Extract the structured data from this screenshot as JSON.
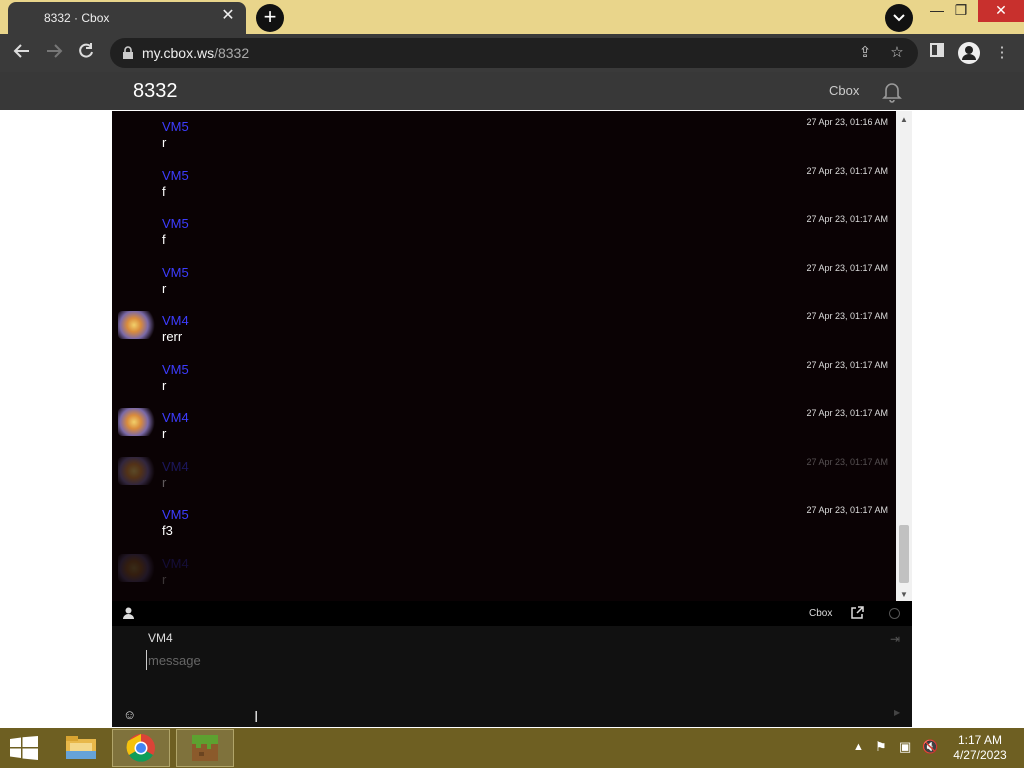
{
  "browser": {
    "tab_title": "8332 · Cbox",
    "tab_close": "✕",
    "new_tab": "+",
    "url_host": "my.cbox.ws",
    "url_path": "/8332",
    "window_minimize": "—",
    "window_restore": "❐",
    "window_close": "✕"
  },
  "site": {
    "title": "8332",
    "brand": "Cbox"
  },
  "chat": {
    "messages": [
      {
        "name": "VM5",
        "text": "r",
        "time": "27 Apr 23, 01:16 AM",
        "avatar": false
      },
      {
        "name": "VM5",
        "text": "f",
        "time": "27 Apr 23, 01:17 AM",
        "avatar": false
      },
      {
        "name": "VM5",
        "text": "f",
        "time": "27 Apr 23, 01:17 AM",
        "avatar": false
      },
      {
        "name": "VM5",
        "text": "r",
        "time": "27 Apr 23, 01:17 AM",
        "avatar": false
      },
      {
        "name": "VM4",
        "text": "rerr",
        "time": "27 Apr 23, 01:17 AM",
        "avatar": true
      },
      {
        "name": "VM5",
        "text": "r",
        "time": "27 Apr 23, 01:17 AM",
        "avatar": false
      },
      {
        "name": "VM4",
        "text": "r",
        "time": "27 Apr 23, 01:17 AM",
        "avatar": true
      },
      {
        "name": "VM4",
        "text": "r",
        "time": "27 Apr 23, 01:17 AM",
        "avatar": true
      },
      {
        "name": "VM5",
        "text": "f3",
        "time": "27 Apr 23, 01:17 AM",
        "avatar": false
      },
      {
        "name": "VM4",
        "text": "r",
        "time": "",
        "avatar": true
      }
    ],
    "toolbar_brand": "Cbox",
    "compose_name": "VM4",
    "message_placeholder": "message",
    "message_value": ""
  },
  "taskbar": {
    "time": "1:17 AM",
    "date": "4/27/2023"
  },
  "colors": {
    "tab_strip": "#e9d58b",
    "chat_bg": "#0a0204",
    "username": "#3d3dff",
    "taskbar": "#6e5f22"
  },
  "icons": [
    "windows-start-icon",
    "file-explorer-icon",
    "chrome-icon",
    "minecraft-icon",
    "bell-icon",
    "user-icon",
    "popout-icon",
    "emoji-icon",
    "lock-icon",
    "star-icon",
    "share-icon",
    "profile-icon"
  ]
}
